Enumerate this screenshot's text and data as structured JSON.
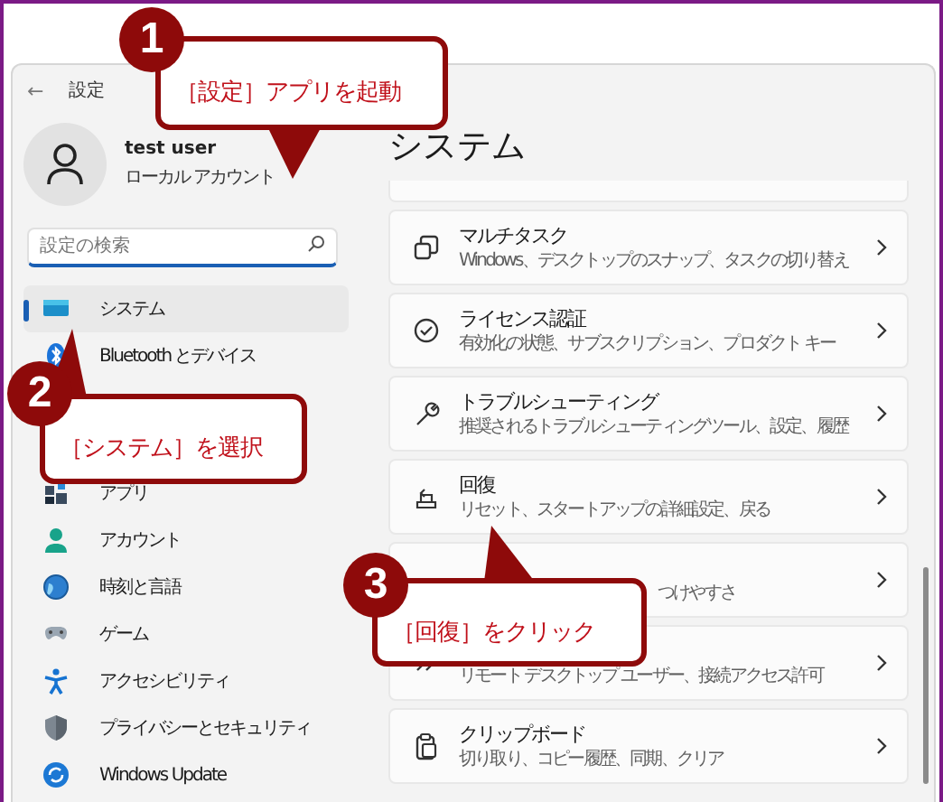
{
  "window": {
    "back": "←",
    "title": "設定"
  },
  "user": {
    "name": "test user",
    "account": "ローカル アカウント"
  },
  "search": {
    "placeholder": "設定の検索"
  },
  "nav": [
    {
      "label": "システム",
      "kind": "display",
      "selected": true
    },
    {
      "label": "Bluetooth とデバイス",
      "kind": "bluetooth",
      "selected": false
    },
    {
      "label": "アプリ",
      "kind": "apps",
      "selected": false
    },
    {
      "label": "アカウント",
      "kind": "account",
      "selected": false
    },
    {
      "label": "時刻と言語",
      "kind": "globe",
      "selected": false
    },
    {
      "label": "ゲーム",
      "kind": "gamepad",
      "selected": false
    },
    {
      "label": "アクセシビリティ",
      "kind": "accessibility",
      "selected": false
    },
    {
      "label": "プライバシーとセキュリティ",
      "kind": "shield",
      "selected": false
    },
    {
      "label": "Windows Update",
      "kind": "update",
      "selected": false
    }
  ],
  "page_title": "システム",
  "cards": [
    {
      "title": "マルチタスク",
      "subtitle": "Windows、デスクトップのスナップ、タスクの切り替え",
      "kind": "windows"
    },
    {
      "title": "ライセンス認証",
      "subtitle": "有効化の状態、サブスクリプション、プロダクト キー",
      "kind": "check"
    },
    {
      "title": "トラブルシューティング",
      "subtitle": "推奨されるトラブルシューティングツール、設定、履歴",
      "kind": "wrench"
    },
    {
      "title": "回復",
      "subtitle": "リセット、スタートアップの詳細設定、戻る",
      "kind": "recovery"
    },
    {
      "subtitle": "つけやすさ",
      "kind": "covered"
    },
    {
      "subtitle": "リモート デスクトップ ユーザー、接続アクセス許可",
      "kind": "remote"
    },
    {
      "title": "クリップボード",
      "subtitle": "切り取り、コピー履歴、同期、クリア",
      "kind": "clipboard"
    }
  ],
  "callouts": [
    {
      "number": "1",
      "text": "［設定］アプリを起動"
    },
    {
      "number": "2",
      "text": "［システム］を選択"
    },
    {
      "number": "3",
      "text": "［回復］をクリック"
    }
  ]
}
